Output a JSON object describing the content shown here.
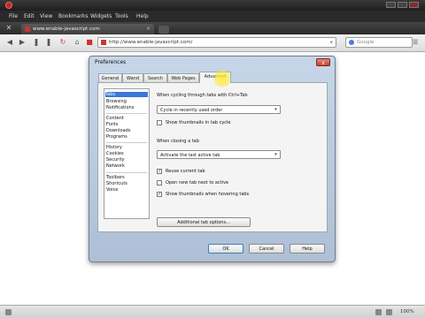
{
  "browser": {
    "menu": [
      "File",
      "Edit",
      "View",
      "Bookmarks",
      "Widgets",
      "Tools",
      "Help"
    ],
    "tab_title": "www.enable-javascript.com",
    "url": "http://www.enable-javascript.com/",
    "search_placeholder": "Google",
    "zoom": "100%"
  },
  "dialog": {
    "title": "Preferences",
    "close_label": "x",
    "tabs": [
      "General",
      "Wand",
      "Search",
      "Web Pages",
      "Advanced"
    ],
    "active_tab": "Advanced",
    "sidebar": [
      "Tabs",
      "Browsing",
      "Notifications",
      "Content",
      "Fonts",
      "Downloads",
      "Programs",
      "History",
      "Cookies",
      "Security",
      "Network",
      "Toolbars",
      "Shortcuts",
      "Voice"
    ],
    "cycling_label": "When cycling through tabs with Ctrl+Tab",
    "cycling_value": "Cycle in recently used order",
    "thumbnails_cycle_label": "Show thumbnails in tab cycle",
    "closing_label": "When closing a tab",
    "closing_value": "Activate the last active tab",
    "reuse_label": "Reuse current tab",
    "open_next_label": "Open new tab next to active",
    "thumbs_hover_label": "Show thumbnails when hovering tabs",
    "additional_button": "Additional tab options...",
    "ok": "OK",
    "cancel": "Cancel",
    "help": "Help"
  }
}
